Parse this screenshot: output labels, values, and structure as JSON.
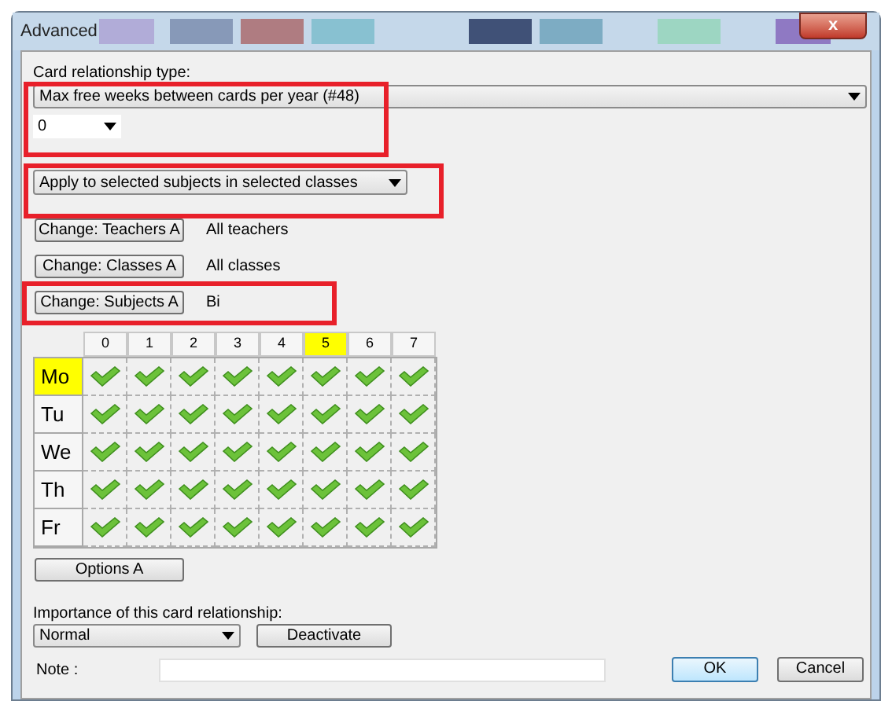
{
  "window": {
    "title": "Advanced",
    "close": "x"
  },
  "relationship": {
    "label": "Card relationship type:",
    "type": "Max free weeks between cards per year (#48)",
    "value": "0",
    "apply": "Apply to selected subjects in selected classes"
  },
  "filters": [
    {
      "button": "Change: Teachers A",
      "value": "All teachers",
      "highlighted": false
    },
    {
      "button": "Change: Classes A",
      "value": "All classes",
      "highlighted": false
    },
    {
      "button": "Change: Subjects A",
      "value": "Bi",
      "highlighted": true
    }
  ],
  "grid": {
    "columns": [
      {
        "label": "0",
        "selected": false
      },
      {
        "label": "1",
        "selected": false
      },
      {
        "label": "2",
        "selected": false
      },
      {
        "label": "3",
        "selected": false
      },
      {
        "label": "4",
        "selected": false
      },
      {
        "label": "5",
        "selected": true
      },
      {
        "label": "6",
        "selected": false
      },
      {
        "label": "7",
        "selected": false
      }
    ],
    "rows": [
      {
        "label": "Mo",
        "selected": true,
        "cells": [
          {
            "checked": true
          },
          {
            "checked": true
          },
          {
            "checked": true
          },
          {
            "checked": true
          },
          {
            "checked": true
          },
          {
            "checked": true
          },
          {
            "checked": true
          },
          {
            "checked": true
          }
        ]
      },
      {
        "label": "Tu",
        "selected": false,
        "cells": [
          {
            "checked": true
          },
          {
            "checked": true
          },
          {
            "checked": true
          },
          {
            "checked": true
          },
          {
            "checked": true
          },
          {
            "checked": true
          },
          {
            "checked": true
          },
          {
            "checked": true
          }
        ]
      },
      {
        "label": "We",
        "selected": false,
        "cells": [
          {
            "checked": true
          },
          {
            "checked": true
          },
          {
            "checked": true
          },
          {
            "checked": true
          },
          {
            "checked": true
          },
          {
            "checked": true
          },
          {
            "checked": true
          },
          {
            "checked": true
          }
        ]
      },
      {
        "label": "Th",
        "selected": false,
        "cells": [
          {
            "checked": true
          },
          {
            "checked": true
          },
          {
            "checked": true
          },
          {
            "checked": true
          },
          {
            "checked": true
          },
          {
            "checked": true
          },
          {
            "checked": true
          },
          {
            "checked": true
          }
        ]
      },
      {
        "label": "Fr",
        "selected": false,
        "cells": [
          {
            "checked": true
          },
          {
            "checked": true
          },
          {
            "checked": true
          },
          {
            "checked": true
          },
          {
            "checked": true
          },
          {
            "checked": true
          },
          {
            "checked": true
          },
          {
            "checked": true
          }
        ]
      }
    ]
  },
  "options_button": "Options A",
  "importance": {
    "label": "Importance of this card relationship:",
    "value": "Normal",
    "deactivate": "Deactivate"
  },
  "note": {
    "label": "Note :"
  },
  "buttons": [
    {
      "label": "OK",
      "default": true
    },
    {
      "label": "Cancel",
      "default": false
    }
  ]
}
